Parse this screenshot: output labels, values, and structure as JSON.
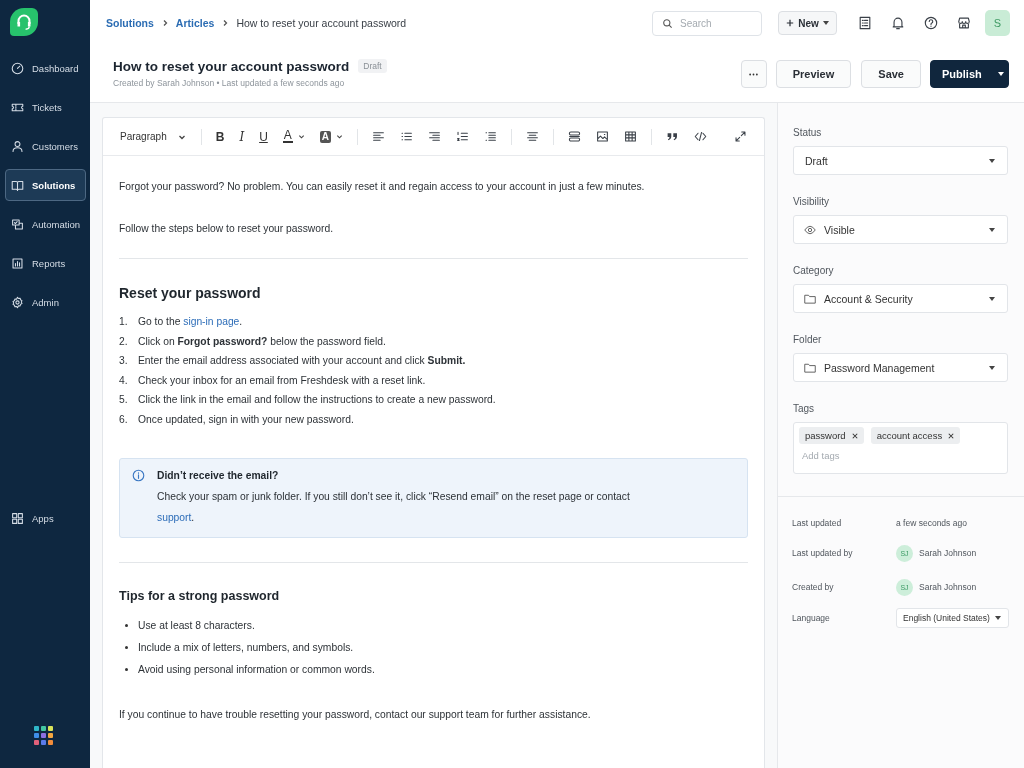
{
  "sidebar": {
    "items": [
      {
        "label": "Dashboard",
        "selected": false
      },
      {
        "label": "Tickets",
        "selected": false
      },
      {
        "label": "Customers",
        "selected": false
      },
      {
        "label": "Solutions",
        "selected": true
      },
      {
        "label": "Automation",
        "selected": false
      },
      {
        "label": "Reports",
        "selected": false
      },
      {
        "label": "Admin",
        "selected": false
      }
    ],
    "bottom_items": [
      {
        "label": "Apps",
        "selected": false
      }
    ]
  },
  "breadcrumbs": [
    {
      "label": "Solutions",
      "kind": "link"
    },
    {
      "label": "Articles",
      "kind": "link"
    },
    {
      "label": "How to reset your account password",
      "kind": "current"
    }
  ],
  "search": {
    "placeholder": "Search"
  },
  "new_button": {
    "label": "New"
  },
  "avatar": {
    "initial": "S"
  },
  "article": {
    "title": "How to reset your account password",
    "status": "Draft",
    "meta": "Created by Sarah Johnson • Last updated a few seconds ago"
  },
  "actions": [
    {
      "kind": "more"
    },
    {
      "kind": "secondary",
      "label": "Preview"
    },
    {
      "kind": "secondary",
      "label": "Save"
    },
    {
      "kind": "primary",
      "label": "Publish"
    }
  ],
  "editor": {
    "toolbar": {
      "block_format": "Paragraph",
      "format_buttons": [
        {
          "kind": "bold",
          "label": "B"
        },
        {
          "kind": "italic",
          "label": "I"
        },
        {
          "kind": "underline",
          "label": "U"
        },
        {
          "kind": "text_color",
          "label": "A"
        },
        {
          "kind": "highlight",
          "label": "A"
        }
      ]
    },
    "content": [
      {
        "kind": "paragraph",
        "text": "Forgot your password? No problem. You can easily reset it and regain access to your account in just a few minutes."
      },
      {
        "kind": "paragraph",
        "text": "Follow the steps below to reset your password."
      },
      {
        "kind": "divider"
      },
      {
        "kind": "heading",
        "text": "Reset your password"
      },
      {
        "kind": "ordered_list",
        "items": [
          {
            "number": "1.",
            "parts": [
              {
                "kind": "text",
                "text": "Go to the "
              },
              {
                "kind": "link",
                "text": "sign-in page"
              },
              {
                "kind": "text",
                "text": "."
              }
            ]
          },
          {
            "number": "2.",
            "parts": [
              {
                "kind": "text",
                "text": "Click on **Forgot password?** below the password field."
              }
            ]
          },
          {
            "number": "3.",
            "parts": [
              {
                "kind": "text",
                "text": "Enter the email address associated with your account and click **Submit.**"
              }
            ]
          },
          {
            "number": "4.",
            "parts": [
              {
                "kind": "text",
                "text": "Check your inbox for an email from Freshdesk with a reset link."
              }
            ]
          },
          {
            "number": "5.",
            "parts": [
              {
                "kind": "text",
                "text": "Click the link in the email and follow the instructions to create a new password."
              }
            ]
          },
          {
            "number": "6.",
            "parts": [
              {
                "kind": "text",
                "text": "Once updated, sign in with your new password."
              }
            ]
          }
        ]
      },
      {
        "kind": "callout",
        "title": "Didn’t receive the email?",
        "parts": [
          {
            "kind": "text",
            "text": "Check your spam or junk folder. If you still don’t see it, click “Resend email” on the reset page or contact "
          },
          {
            "kind": "link",
            "text": "support"
          },
          {
            "kind": "text",
            "text": "."
          }
        ]
      },
      {
        "kind": "divider"
      },
      {
        "kind": "subheading",
        "text": "Tips for a strong password"
      },
      {
        "kind": "bullet_list",
        "items": [
          "Use at least 8 characters.",
          "Include a mix of letters, numbers, and symbols.",
          "Avoid using personal information or common words."
        ]
      },
      {
        "kind": "paragraph",
        "text": "If you continue to have trouble resetting your password, contact our support team for further assistance."
      }
    ]
  },
  "properties": {
    "fields": [
      {
        "label": "Status",
        "kind": "plain_select",
        "value": "Draft"
      },
      {
        "label": "Visibility",
        "kind": "visibility_select",
        "value": "Visible"
      },
      {
        "label": "Category",
        "kind": "folder_select",
        "value": "Account & Security"
      },
      {
        "label": "Folder",
        "kind": "folder_select",
        "value": "Password Management"
      },
      {
        "label": "Tags",
        "kind": "tags",
        "tags": [
          "password",
          "account access"
        ],
        "placeholder": "Add tags"
      }
    ],
    "meta": [
      {
        "label": "Last updated",
        "kind": "text",
        "value": "a few seconds ago"
      },
      {
        "label": "Last updated by",
        "kind": "person",
        "initials": "SJ",
        "value": "Sarah Johnson"
      },
      {
        "label": "Created by",
        "kind": "person",
        "initials": "SJ",
        "value": "Sarah Johnson"
      },
      {
        "label": "Language",
        "kind": "select",
        "value": "English (United States)"
      }
    ]
  }
}
